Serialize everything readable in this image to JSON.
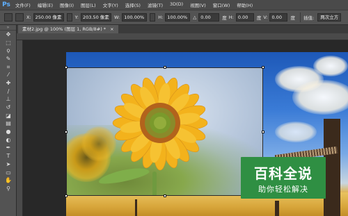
{
  "app": {
    "logo": "Ps"
  },
  "menu": [
    "文件(F)",
    "编辑(E)",
    "图像(I)",
    "图层(L)",
    "文字(Y)",
    "选择(S)",
    "滤镜(T)",
    "3D(D)",
    "视图(V)",
    "窗口(W)",
    "帮助(H)"
  ],
  "options": {
    "x_label": "X:",
    "x_value": "250.00 像素",
    "y_label": "Y:",
    "y_value": "203.50 像素",
    "w_label": "W:",
    "w_value": "100.00%",
    "h_label": "H:",
    "h_value": "100.00%",
    "angle_value": "0.00",
    "angle_unit": "度",
    "h_skew_label": "H:",
    "h_skew_value": "0.00",
    "h_skew_unit": "度",
    "v_skew_label": "V:",
    "v_skew_value": "0.00",
    "v_skew_unit": "度",
    "interp_label": "插值:",
    "interp_value": "两次立方"
  },
  "document_tab": {
    "title": "素材2.jpg @ 100% (图层 1, RGB/8#) *",
    "close": "×"
  },
  "tools": [
    "move-tool",
    "marquee-tool",
    "lasso-tool",
    "quick-select-tool",
    "crop-tool",
    "eyedropper-tool",
    "healing-brush-tool",
    "brush-tool",
    "clone-stamp-tool",
    "history-brush-tool",
    "eraser-tool",
    "gradient-tool",
    "blur-tool",
    "dodge-tool",
    "pen-tool",
    "type-tool",
    "path-select-tool",
    "shape-tool",
    "hand-tool",
    "zoom-tool"
  ],
  "watermark": {
    "title": "百科全说",
    "subtitle": "助你轻松解决",
    "color": "#2f8f43"
  }
}
